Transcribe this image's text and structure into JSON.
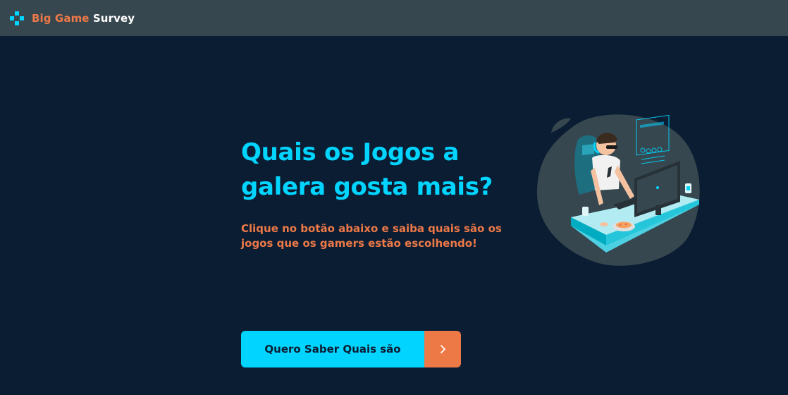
{
  "navbar": {
    "brand_part1": "Big Game",
    "brand_part2": " Survey",
    "icon": "gamepad-icon"
  },
  "hero": {
    "title": "Quais os Jogos a galera gosta mais?",
    "subtitle": "Clique no botão abaixo e saiba quais são os jogos que os gamers estão escolhendo!",
    "cta_label": "Quero Saber Quais são",
    "cta_icon": "chevron-right-icon",
    "illustration": "gamer-at-desk-illustration"
  },
  "colors": {
    "background": "#0b1d33",
    "navbar": "#37474f",
    "primary": "#00d4ff",
    "accent": "#ed7947"
  }
}
